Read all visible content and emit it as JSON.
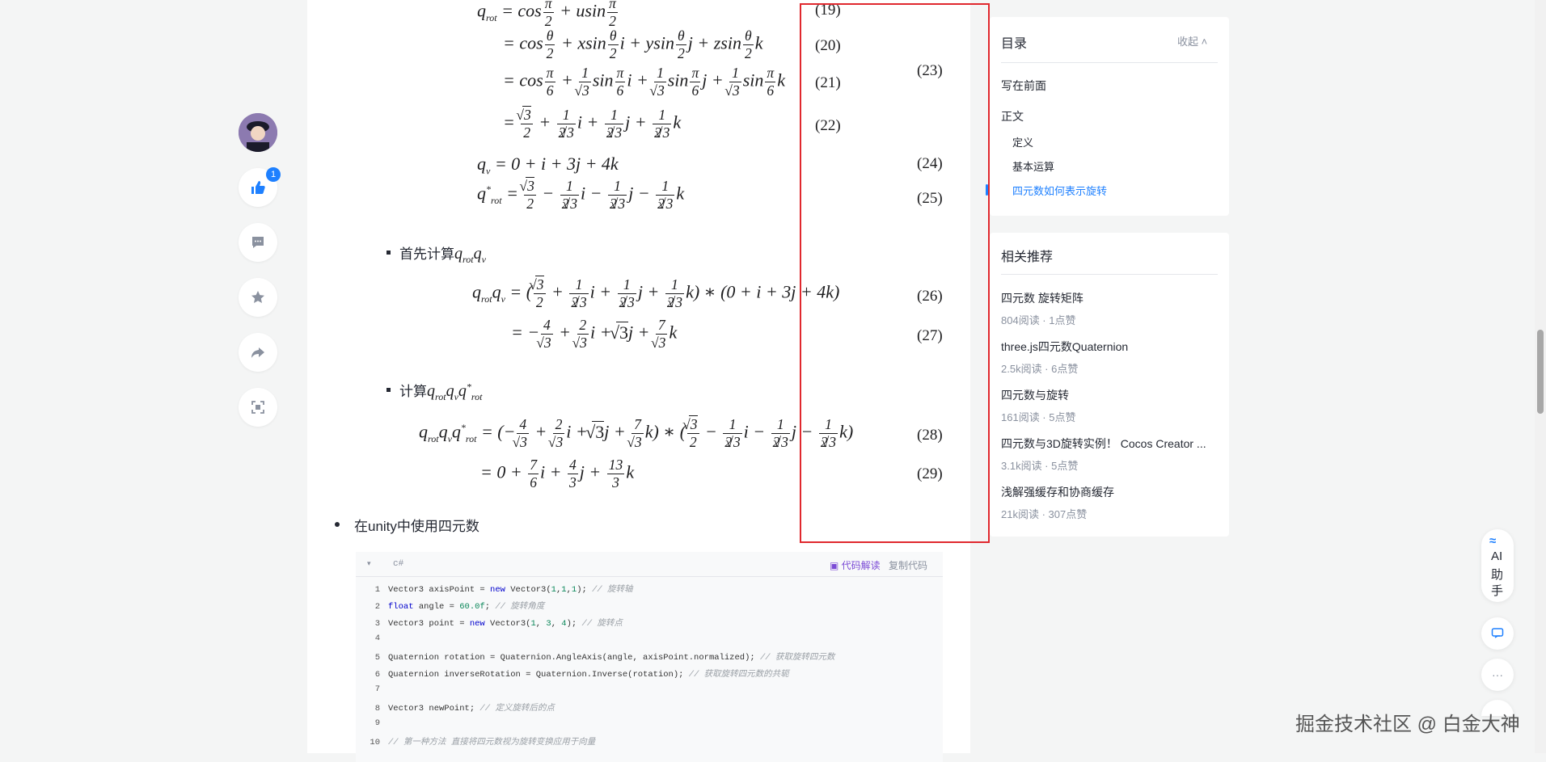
{
  "article": {
    "equations": [
      {
        "text": "q_rot = cos π/2 + u sin π/2",
        "no": "(19)"
      },
      {
        "text": "= cos θ/2 + x sin θ/2 i + y sin θ/2 j + z sin θ/2 k",
        "no": "(20)"
      },
      {
        "text": "= cos π/6 + 1/√3 sin π/6 i + 1/√3 sin π/6 j + 1/√3 sin π/6 k",
        "no": "(21)"
      },
      {
        "text": "= √3/2 + 1/(2√3) i + 1/(2√3) j + 1/(2√3) k",
        "no": "(22)"
      },
      {
        "text": "",
        "no": "(23)"
      },
      {
        "text": "q_v = 0 + i + 3j + 4k",
        "no": "(24)"
      },
      {
        "text": "q*_rot = √3/2 − 1/(2√3) i − 1/(2√3) j − 1/(2√3) k",
        "no": "(25)"
      },
      {
        "text": "q_rot q_v = (√3/2 + 1/(2√3) i + 1/(2√3) j + 1/(2√3) k) ∗ (0 + i + 3j + 4k)",
        "no": "(26)"
      },
      {
        "text": "= −4/√3 + 2/√3 i + √3 j + 7/√3 k",
        "no": "(27)"
      },
      {
        "text": "q_rot q_v q*_rot = (−4/√3 + 2/√3 i + √3 j + 7/√3 k) ∗ (√3/2 − 1/(2√3) i − 1/(2√3) j − 1/(2√3) k)",
        "no": "(28)"
      },
      {
        "text": "= 0 + 7/6 i + 4/3 j + 13/3 k",
        "no": "(29)"
      }
    ],
    "bullet1_text": "首先计算",
    "bullet1_math": "q_rot q_v",
    "bullet2_text": "计算",
    "bullet2_math": "q_rot q_v q*_rot",
    "bullet3_text": "在unity中使用四元数"
  },
  "code": {
    "lang": "c#",
    "explain_label": "代码解读",
    "copy_label": "复制代码",
    "lines": [
      {
        "n": "1",
        "text": "Vector3 axisPoint = new Vector3(1,1,1); // 旋转轴"
      },
      {
        "n": "2",
        "text": "float angle = 60.0f; // 旋转角度"
      },
      {
        "n": "3",
        "text": "Vector3 point = new Vector3(1, 3, 4); // 旋转点"
      },
      {
        "n": "4",
        "text": ""
      },
      {
        "n": "5",
        "text": "Quaternion rotation = Quaternion.AngleAxis(angle, axisPoint.normalized); // 获取旋转四元数"
      },
      {
        "n": "6",
        "text": "Quaternion inverseRotation = Quaternion.Inverse(rotation); // 获取旋转四元数的共轭"
      },
      {
        "n": "7",
        "text": ""
      },
      {
        "n": "8",
        "text": "Vector3 newPoint; // 定义旋转后的点"
      },
      {
        "n": "9",
        "text": ""
      },
      {
        "n": "10",
        "text": "// 第一种方法 直接将四元数视为旋转变换应用于向量"
      }
    ]
  },
  "actions": {
    "like_count": "1"
  },
  "toc": {
    "title": "目录",
    "collapse": "收起",
    "items": [
      {
        "label": "写在前面"
      },
      {
        "label": "正文"
      },
      {
        "label": "定义"
      },
      {
        "label": "基本运算"
      },
      {
        "label": "四元数如何表示旋转"
      }
    ]
  },
  "recommend": {
    "title": "相关推荐",
    "items": [
      {
        "title": "四元数 旋转矩阵",
        "meta": "804阅读 · 1点赞"
      },
      {
        "title": "three.js四元数Quaternion",
        "meta": "2.5k阅读 · 6点赞"
      },
      {
        "title": "四元数与旋转",
        "meta": "161阅读 · 5点赞"
      },
      {
        "title": "四元数与3D旋转实例！ Cocos Creator ...",
        "meta": "3.1k阅读 · 5点赞"
      },
      {
        "title": "浅解强缓存和协商缓存",
        "meta": "21k阅读 · 307点赞"
      }
    ]
  },
  "ai": {
    "label_1": "AI",
    "label_2": "助",
    "label_3": "手"
  },
  "watermark": "掘金技术社区 @ 白金大神",
  "colors": {
    "accent": "#1e80ff",
    "highlight_box": "#e0282e"
  }
}
